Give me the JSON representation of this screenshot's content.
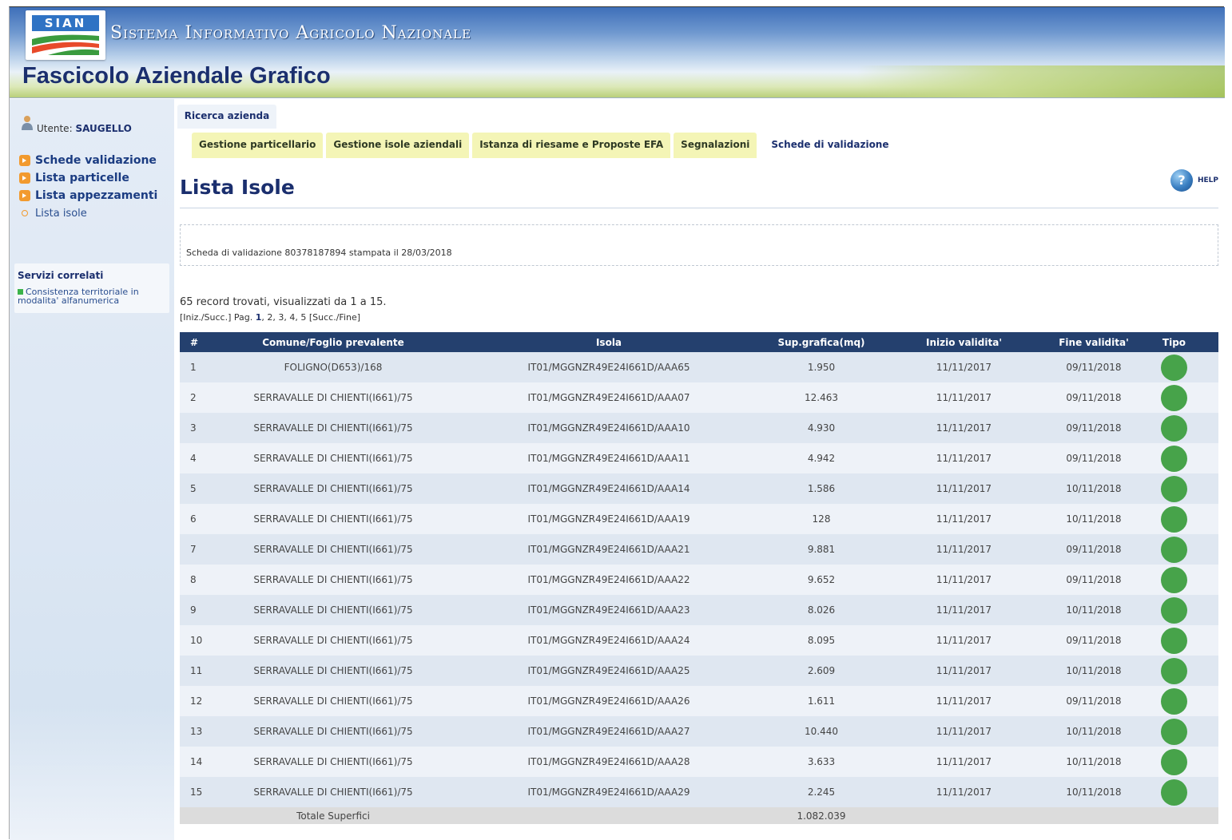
{
  "header": {
    "logo_text": "SIAN",
    "system_title": "Sistema Informativo Agricolo Nazionale",
    "app_title": "Fascicolo Aziendale Grafico"
  },
  "sidebar": {
    "user_label": "Utente:",
    "user_name": "SAUGELLO",
    "items": [
      {
        "label": "Schede validazione"
      },
      {
        "label": "Lista particelle"
      },
      {
        "label": "Lista appezzamenti"
      },
      {
        "label": "Lista isole"
      }
    ],
    "related_title": "Servizi correlati",
    "related_item": "Consistenza territoriale in modalita' alfanumerica"
  },
  "main": {
    "search_button": "Ricerca azienda",
    "tabs": [
      {
        "label": "Gestione particellario"
      },
      {
        "label": "Gestione isole aziendali"
      },
      {
        "label": "Istanza di riesame e Proposte EFA"
      },
      {
        "label": "Segnalazioni"
      },
      {
        "label": "Schede di validazione"
      }
    ],
    "page_title": "Lista Isole",
    "help_label": "HELP",
    "help_glyph": "?",
    "note": "Scheda di validazione 80378187894 stampata il 28/03/2018",
    "record_info": "65 record trovati, visualizzati da 1 a 15.",
    "pager": {
      "prefix": "[Iniz./Succ.] Pag.",
      "pages": [
        "1",
        "2",
        "3",
        "4",
        "5"
      ],
      "suffix": "[Succ./Fine]"
    }
  },
  "table": {
    "headers": {
      "num": "#",
      "comune": "Comune/Foglio prevalente",
      "isola": "Isola",
      "sup": "Sup.grafica(mq)",
      "inizio": "Inizio validita'",
      "fine": "Fine validita'",
      "tipo": "Tipo"
    },
    "rows": [
      {
        "num": "1",
        "comune": "FOLIGNO(D653)/168",
        "isola": "IT01/MGGNZR49E24I661D/AAA65",
        "sup": "1.950",
        "inizio": "11/11/2017",
        "fine": "09/11/2018"
      },
      {
        "num": "2",
        "comune": "SERRAVALLE DI CHIENTI(I661)/75",
        "isola": "IT01/MGGNZR49E24I661D/AAA07",
        "sup": "12.463",
        "inizio": "11/11/2017",
        "fine": "09/11/2018"
      },
      {
        "num": "3",
        "comune": "SERRAVALLE DI CHIENTI(I661)/75",
        "isola": "IT01/MGGNZR49E24I661D/AAA10",
        "sup": "4.930",
        "inizio": "11/11/2017",
        "fine": "09/11/2018"
      },
      {
        "num": "4",
        "comune": "SERRAVALLE DI CHIENTI(I661)/75",
        "isola": "IT01/MGGNZR49E24I661D/AAA11",
        "sup": "4.942",
        "inizio": "11/11/2017",
        "fine": "09/11/2018"
      },
      {
        "num": "5",
        "comune": "SERRAVALLE DI CHIENTI(I661)/75",
        "isola": "IT01/MGGNZR49E24I661D/AAA14",
        "sup": "1.586",
        "inizio": "11/11/2017",
        "fine": "10/11/2018"
      },
      {
        "num": "6",
        "comune": "SERRAVALLE DI CHIENTI(I661)/75",
        "isola": "IT01/MGGNZR49E24I661D/AAA19",
        "sup": "128",
        "inizio": "11/11/2017",
        "fine": "10/11/2018"
      },
      {
        "num": "7",
        "comune": "SERRAVALLE DI CHIENTI(I661)/75",
        "isola": "IT01/MGGNZR49E24I661D/AAA21",
        "sup": "9.881",
        "inizio": "11/11/2017",
        "fine": "09/11/2018"
      },
      {
        "num": "8",
        "comune": "SERRAVALLE DI CHIENTI(I661)/75",
        "isola": "IT01/MGGNZR49E24I661D/AAA22",
        "sup": "9.652",
        "inizio": "11/11/2017",
        "fine": "09/11/2018"
      },
      {
        "num": "9",
        "comune": "SERRAVALLE DI CHIENTI(I661)/75",
        "isola": "IT01/MGGNZR49E24I661D/AAA23",
        "sup": "8.026",
        "inizio": "11/11/2017",
        "fine": "10/11/2018"
      },
      {
        "num": "10",
        "comune": "SERRAVALLE DI CHIENTI(I661)/75",
        "isola": "IT01/MGGNZR49E24I661D/AAA24",
        "sup": "8.095",
        "inizio": "11/11/2017",
        "fine": "09/11/2018"
      },
      {
        "num": "11",
        "comune": "SERRAVALLE DI CHIENTI(I661)/75",
        "isola": "IT01/MGGNZR49E24I661D/AAA25",
        "sup": "2.609",
        "inizio": "11/11/2017",
        "fine": "10/11/2018"
      },
      {
        "num": "12",
        "comune": "SERRAVALLE DI CHIENTI(I661)/75",
        "isola": "IT01/MGGNZR49E24I661D/AAA26",
        "sup": "1.611",
        "inizio": "11/11/2017",
        "fine": "09/11/2018"
      },
      {
        "num": "13",
        "comune": "SERRAVALLE DI CHIENTI(I661)/75",
        "isola": "IT01/MGGNZR49E24I661D/AAA27",
        "sup": "10.440",
        "inizio": "11/11/2017",
        "fine": "10/11/2018"
      },
      {
        "num": "14",
        "comune": "SERRAVALLE DI CHIENTI(I661)/75",
        "isola": "IT01/MGGNZR49E24I661D/AAA28",
        "sup": "3.633",
        "inizio": "11/11/2017",
        "fine": "10/11/2018"
      },
      {
        "num": "15",
        "comune": "SERRAVALLE DI CHIENTI(I661)/75",
        "isola": "IT01/MGGNZR49E24I661D/AAA29",
        "sup": "2.245",
        "inizio": "11/11/2017",
        "fine": "10/11/2018"
      }
    ],
    "type_color": "#47a34a",
    "total_label": "Totale Superfici",
    "total_value": "1.082.039"
  },
  "colors": {
    "header_blue": "#24406e",
    "title_blue": "#1b2f6e",
    "tab_yellow": "#f4f5b6",
    "nav_bullet": "#f29a2e"
  }
}
